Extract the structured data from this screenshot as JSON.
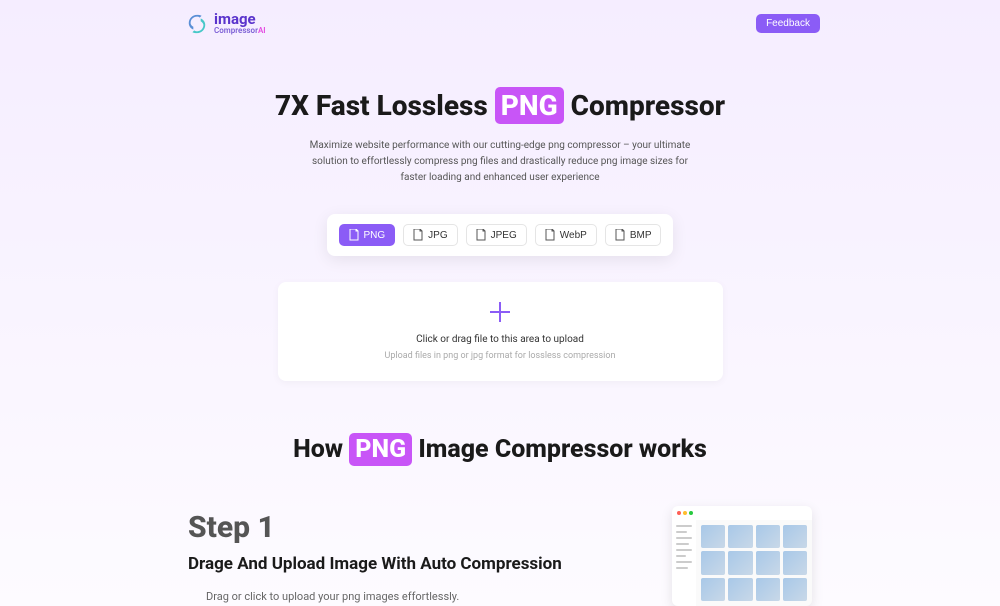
{
  "header": {
    "logo_title": "image",
    "logo_sub_compressor": "Compressor",
    "logo_sub_ai": "AI",
    "feedback_label": "Feedback"
  },
  "hero": {
    "title_prefix": "7X Fast Lossless ",
    "title_badge": "PNG",
    "title_suffix": " Compressor",
    "description": "Maximize website performance with our cutting-edge png compressor – your ultimate solution to effortlessly compress png files and drastically reduce png image sizes for faster loading and enhanced user experience"
  },
  "formats": {
    "png": "PNG",
    "jpg": "JPG",
    "jpeg": "JPEG",
    "webp": "WebP",
    "bmp": "BMP"
  },
  "upload": {
    "text": "Click or drag file to this area to upload",
    "hint": "Upload files in png or jpg format for lossless compression"
  },
  "how": {
    "title_prefix": "How ",
    "title_badge": "PNG",
    "title_suffix": " Image Compressor works"
  },
  "step1": {
    "num": "Step 1",
    "title": "Drage And Upload Image With Auto Compression",
    "desc": "Drag or click to upload your png images effortlessly."
  }
}
